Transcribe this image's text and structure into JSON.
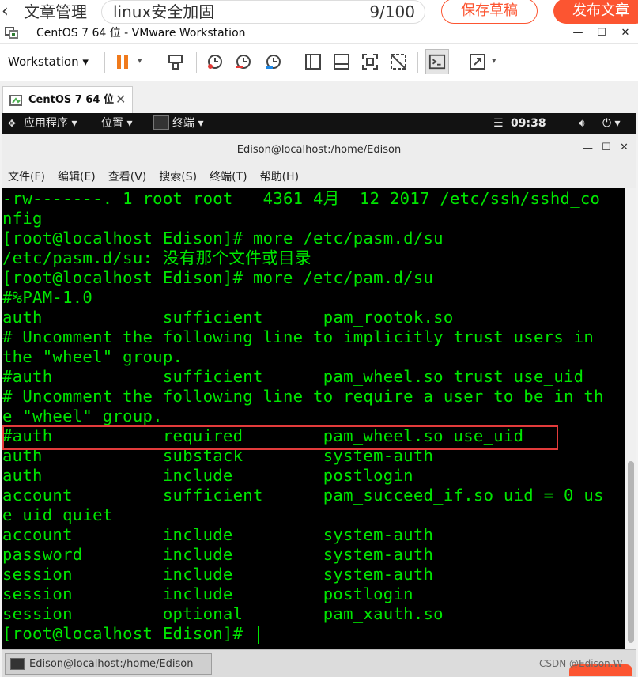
{
  "editor": {
    "back_label": "文章管理",
    "title_value": "linux安全加固",
    "title_count": "9/100",
    "save_draft_label": "保存草稿",
    "publish_label": "发布文章"
  },
  "vmware": {
    "window_title": "CentOS 7 64 位 - VMware Workstation",
    "workstation_menu": "Workstation",
    "tab_label": "CentOS 7 64 位",
    "brand_color": "#fc5531"
  },
  "gnome": {
    "applications": "应用程序",
    "places": "位置",
    "terminal": "终端",
    "clock": "09:38"
  },
  "terminal": {
    "title": "Edison@localhost:/home/Edison",
    "menu": [
      "文件(F)",
      "编辑(E)",
      "查看(V)",
      "搜索(S)",
      "终端(T)",
      "帮助(H)"
    ],
    "text_color": "#00e600",
    "lines": [
      "-rw-------. 1 root root   4361 4月  12 2017 /etc/ssh/sshd_co",
      "nfig",
      "[root@localhost Edison]# more /etc/pasm.d/su",
      "/etc/pasm.d/su: 没有那个文件或目录",
      "[root@localhost Edison]# more /etc/pam.d/su",
      "#%PAM-1.0",
      "auth            sufficient      pam_rootok.so",
      "# Uncomment the following line to implicitly trust users in",
      "the \"wheel\" group.",
      "#auth           sufficient      pam_wheel.so trust use_uid",
      "# Uncomment the following line to require a user to be in th",
      "e \"wheel\" group.",
      "#auth           required        pam_wheel.so use_uid",
      "auth            substack        system-auth",
      "auth            include         postlogin",
      "account         sufficient      pam_succeed_if.so uid = 0 us",
      "e_uid quiet",
      "account         include         system-auth",
      "password        include         system-auth",
      "session         include         system-auth",
      "session         include         postlogin",
      "session         optional        pam_xauth.so",
      "[root@localhost Edison]# "
    ]
  },
  "taskbar": {
    "item_label": "Edison@localhost:/home/Edison",
    "watermark": "CSDN @Edison.W"
  }
}
